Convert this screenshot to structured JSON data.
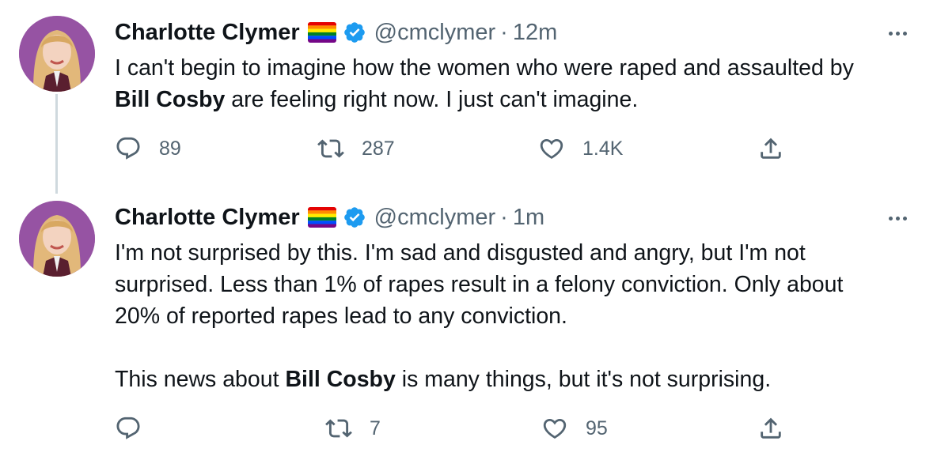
{
  "colors": {
    "text_primary": "#0f1419",
    "text_secondary": "#536471",
    "verified_blue": "#1d9bf0",
    "thread_line": "#cfd9de"
  },
  "tweets": [
    {
      "author_name": "Charlotte Clymer",
      "handle": "@cmclymer",
      "separator": "·",
      "time": "12m",
      "badges": [
        "rainbow-flag-icon",
        "verified-badge-icon"
      ],
      "text_a": "I can't begin to imagine how the women who were raped and assaulted by\n",
      "text_bold_1": "Bill Cosby",
      "text_b": " are feeling right now. I just can't imagine.",
      "reply_count": "89",
      "retweet_count": "287",
      "like_count": "1.4K"
    },
    {
      "author_name": "Charlotte Clymer",
      "handle": "@cmclymer",
      "separator": "·",
      "time": "1m",
      "badges": [
        "rainbow-flag-icon",
        "verified-badge-icon"
      ],
      "text_a": "I'm not surprised by this. I'm sad and disgusted and angry, but I'm not\nsurprised. Less than 1% of rapes result in a felony conviction. Only about\n20% of reported rapes lead to any conviction.\n\nThis news about ",
      "text_bold_1": "Bill Cosby",
      "text_b": " is many things, but it's not surprising.",
      "reply_count": "",
      "retweet_count": "7",
      "like_count": "95"
    }
  ]
}
